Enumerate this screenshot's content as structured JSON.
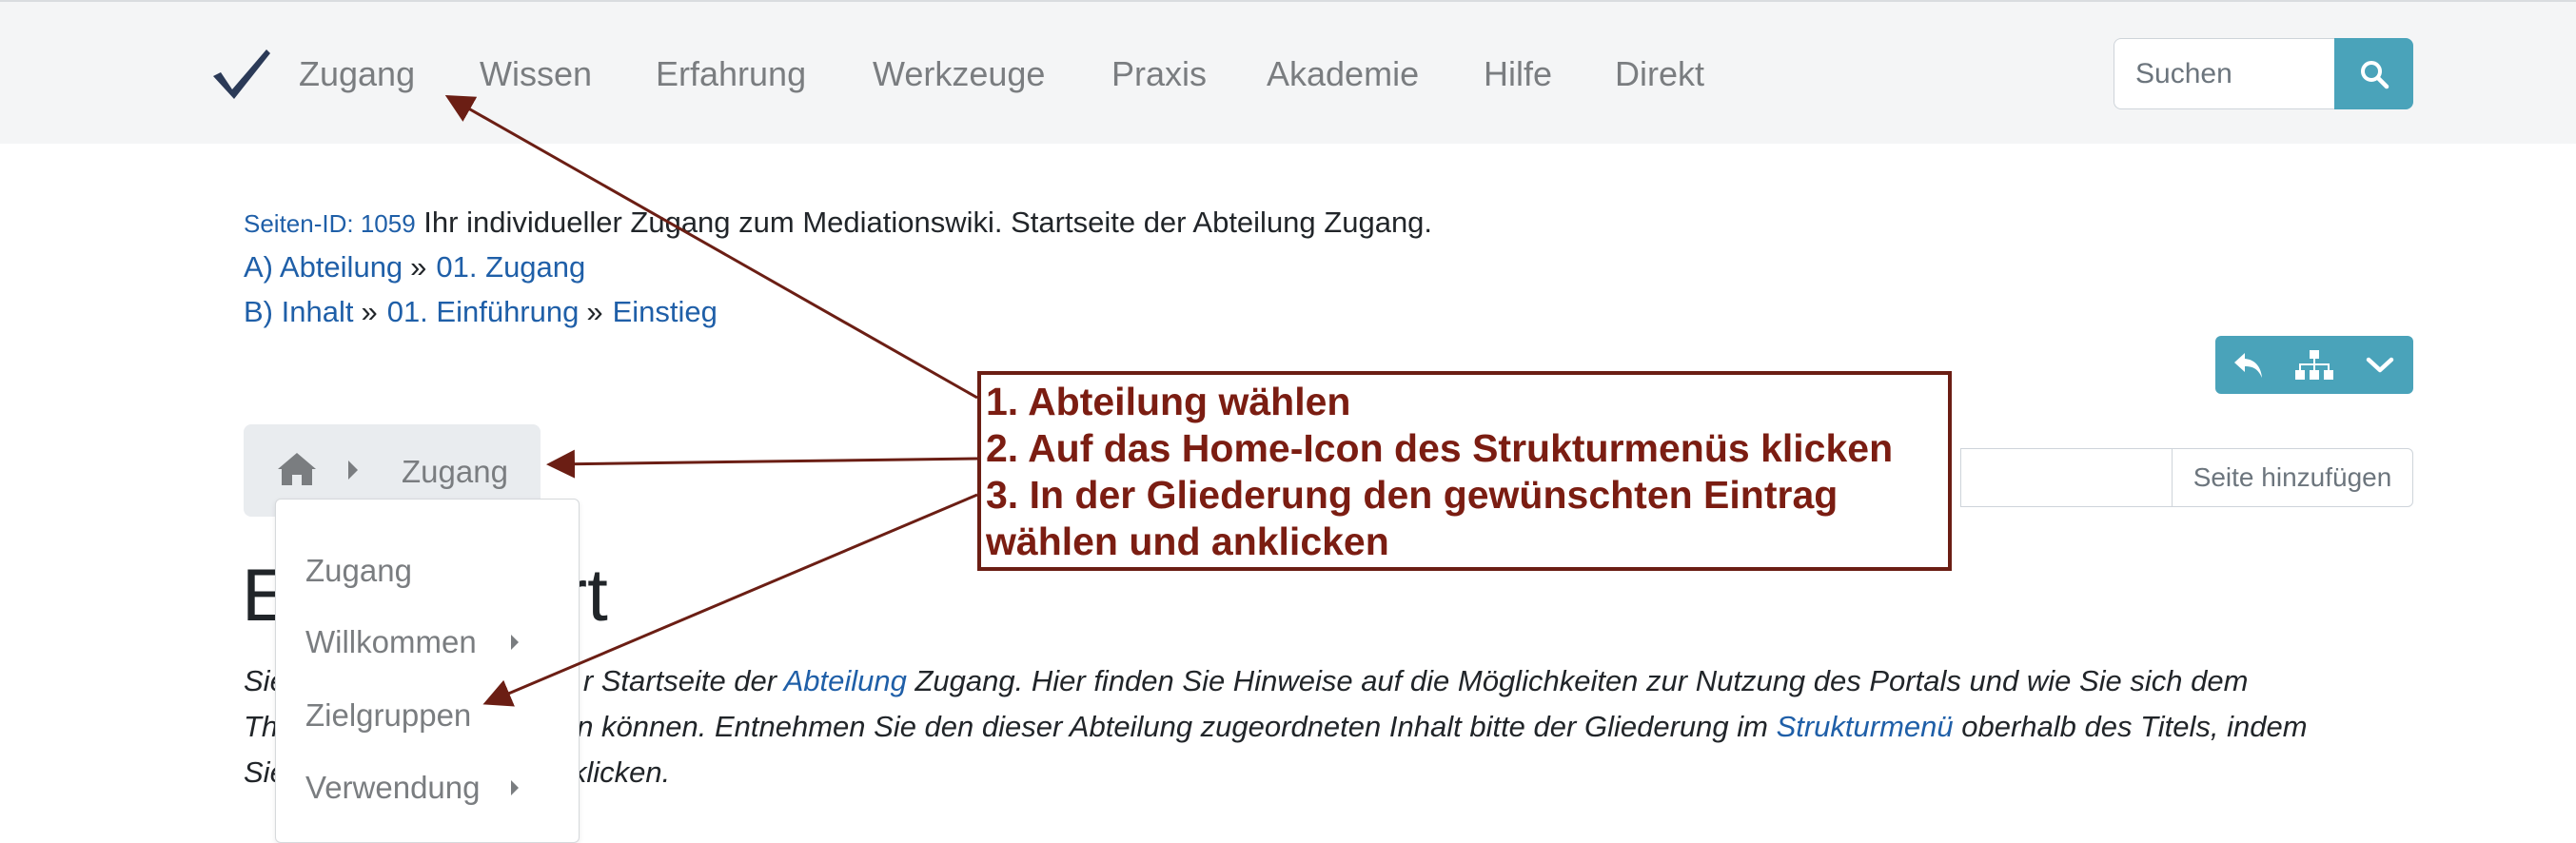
{
  "nav": {
    "items": [
      "Zugang",
      "Wissen",
      "Erfahrung",
      "Werkzeuge",
      "Praxis",
      "Akademie",
      "Hilfe",
      "Direkt"
    ],
    "search_placeholder": "Suchen",
    "accent_color": "#4aa3ba"
  },
  "meta": {
    "page_id_label": "Seiten-ID: 1059",
    "page_description": "Ihr individueller Zugang zum Mediationswiki. Startseite der Abteilung Zugang.",
    "breadcrumb_a": [
      "A) Abteilung",
      "01. Zugang"
    ],
    "breadcrumb_b": [
      "B) Inhalt",
      "01. Einführung",
      "Einstieg"
    ],
    "separator": "»"
  },
  "toolbar": {
    "icons": [
      "reply-icon",
      "sitemap-icon",
      "chevron-down-icon"
    ]
  },
  "structure_menu": {
    "crumb_label": "Zugang",
    "dropdown_items": [
      {
        "label": "Zugang",
        "has_submenu": false
      },
      {
        "label": "Willkommen",
        "has_submenu": true
      },
      {
        "label": "Zielgruppen",
        "has_submenu": false
      },
      {
        "label": "Verwendung",
        "has_submenu": true
      }
    ],
    "add_page_label": "Seite hinzufügen"
  },
  "title": {
    "visible_start": "E",
    "visible_end": "Start"
  },
  "intro": {
    "line1_pre": "Sie",
    "line1_mid": "r Startseite der",
    "line1_link": "Abteilung",
    "line1_post": "Zugang. Hier finden Sie Hinweise auf die Möglichkeiten zur Nutzung des Portals und wie Sie sich dem",
    "line2_pre": "Th",
    "line2_mid": "n können. Entnehmen Sie den dieser Abteilung zugeordneten Inhalt bitte der Gliederung im",
    "line2_link": "Strukturmenü",
    "line2_post": "oberhalb des Titels, indem",
    "line3_pre": "Sie",
    "line3_mid": "klicken."
  },
  "annotation": {
    "lines": [
      "1. Abteilung wählen",
      "2. Auf das Home-Icon des Strukturmenüs klicken",
      "3. In der Gliederung den gewünschten Eintrag",
      "wählen und anklicken"
    ],
    "color": "#7b1d12"
  }
}
